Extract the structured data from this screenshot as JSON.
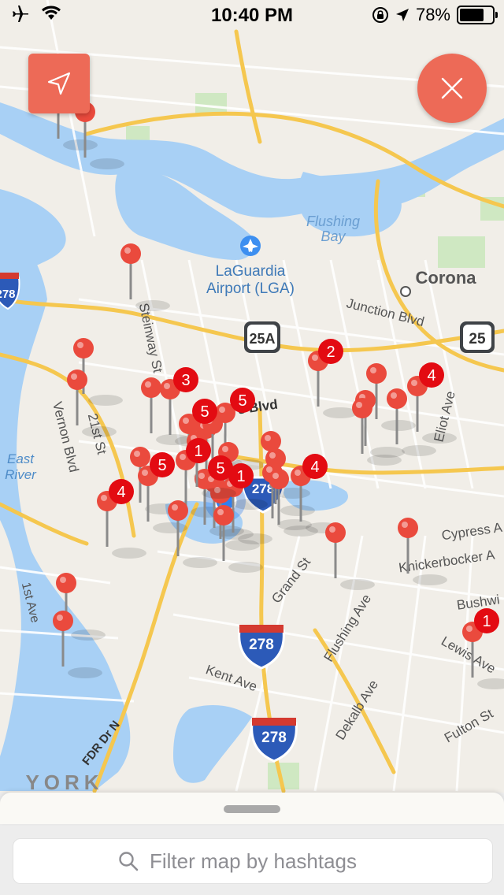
{
  "status_bar": {
    "time": "10:40 PM",
    "battery_percent": "78%",
    "battery_level": 0.78
  },
  "map": {
    "labels": {
      "flushing_bay": [
        "Flushing",
        "Bay"
      ],
      "laguardia": [
        "LaGuardia",
        "Airport (LGA)"
      ],
      "corona": "Corona",
      "junction_blvd": "Junction Blvd",
      "steinway": "Steinway St",
      "vernon": "Vernon Blvd",
      "st21": "21st St",
      "east_river": [
        "East",
        "River"
      ],
      "first_ave": "1st Ave",
      "eliot_ave": "Eliot Ave",
      "cypress": "Cypress A",
      "knickerbocker": "Knickerbocker A",
      "bushwick": "Bushwi",
      "lewis_ave": "Lewis Ave",
      "fulton_st": "Fulton St",
      "dekalb": "Dekalb Ave",
      "flushing_ave": "Flushing Ave",
      "grand_st": "Grand St",
      "kent_ave": "Kent Ave",
      "fdr": "FDR Dr N",
      "york": "YORK",
      "northern_blvd": "s Blvd"
    },
    "shields": {
      "i278": "278",
      "r25a": "25A",
      "r25": "25"
    },
    "clusters": [
      "3",
      "2",
      "4",
      "5",
      "5",
      "1",
      "5",
      "5",
      "1",
      "4",
      "4",
      "1"
    ]
  },
  "buttons": {
    "locate_icon": "navigation-arrow-icon",
    "close_icon": "close-x-icon"
  },
  "search": {
    "placeholder": "Filter map by hashtags"
  },
  "colors": {
    "accent": "#ed6a57",
    "water": "#a8d0f5",
    "pin": "#ea4a3d",
    "badge": "#e30b12"
  }
}
